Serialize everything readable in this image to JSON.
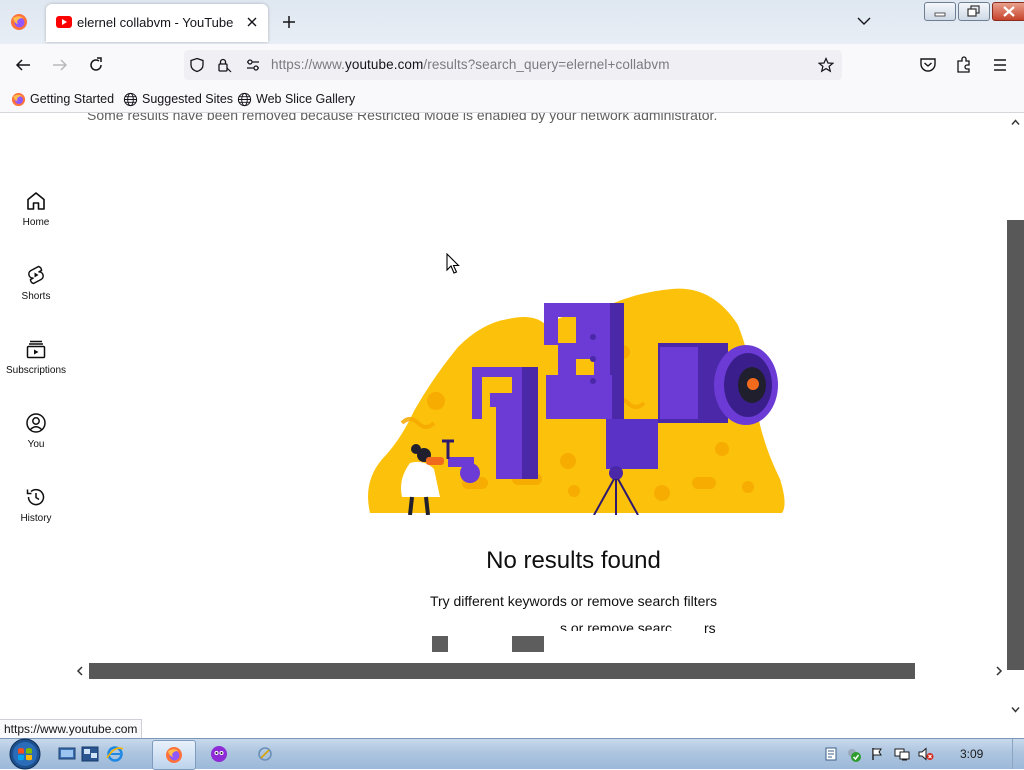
{
  "browser": {
    "tab": {
      "title": "elernel collabvm - YouTube"
    },
    "url": {
      "prefix": "https://www.",
      "domain": "youtube.com",
      "path": "/results?search_query=elernel+collabvm"
    },
    "bookmarks": [
      {
        "label": "Getting Started",
        "icon": "firefox-icon"
      },
      {
        "label": "Suggested Sites",
        "icon": "globe-icon"
      },
      {
        "label": "Web Slice Gallery",
        "icon": "globe-icon"
      }
    ],
    "status_link": "https://www.youtube.com"
  },
  "page": {
    "notice": "Some results have been removed because Restricted Mode is enabled by your network administrator.",
    "sidebar": [
      {
        "label": "Home",
        "icon": "home-icon"
      },
      {
        "label": "Shorts",
        "icon": "shorts-icon"
      },
      {
        "label": "Subscriptions",
        "icon": "subscriptions-icon"
      },
      {
        "label": "You",
        "icon": "user-circle-icon"
      },
      {
        "label": "History",
        "icon": "history-icon"
      }
    ],
    "empty_state": {
      "title": "No results found",
      "subtitle": "Try different keywords or remove search filters",
      "ghost_text_1": "s or remove searc",
      "ghost_text_2": "rs"
    }
  },
  "taskbar": {
    "clock": "3:09"
  },
  "colors": {
    "illustration_yellow": "#fcc10a",
    "illustration_purple": "#6c3bd6",
    "illustration_dark_purple": "#4a28a8",
    "scroll_thumb": "#585858"
  }
}
